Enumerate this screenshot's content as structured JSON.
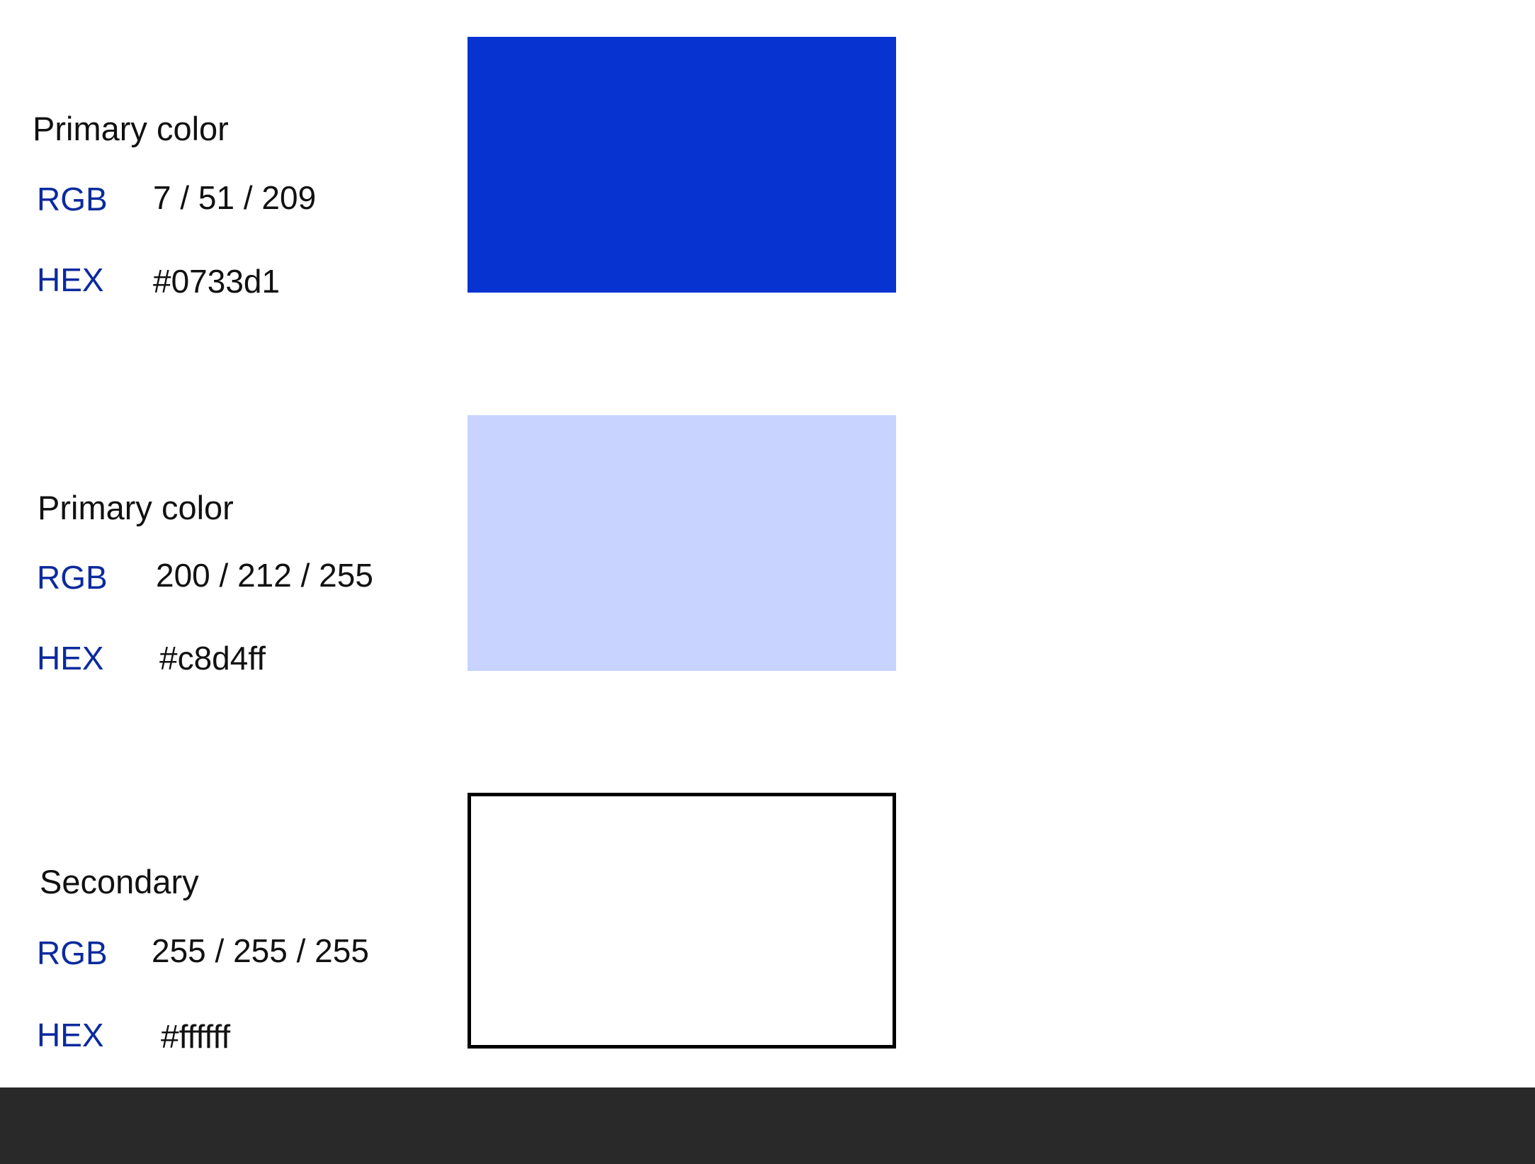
{
  "swatches": [
    {
      "title": "Primary color",
      "rgb_label": "RGB",
      "rgb_value": "7 / 51 / 209",
      "hex_label": "HEX",
      "hex_value": "#0733d1",
      "color": "#0733d1"
    },
    {
      "title": "Primary color",
      "rgb_label": "RGB",
      "rgb_value": "200 / 212 / 255",
      "hex_label": "HEX",
      "hex_value": "#c8d4ff",
      "color": "#c8d4ff"
    },
    {
      "title": "Secondary",
      "rgb_label": "RGB",
      "rgb_value": "255 / 255 / 255",
      "hex_label": "HEX",
      "hex_value": "#ffffff",
      "color": "#ffffff",
      "border_color": "#000000"
    }
  ],
  "bottom_bar_color": "#292929"
}
